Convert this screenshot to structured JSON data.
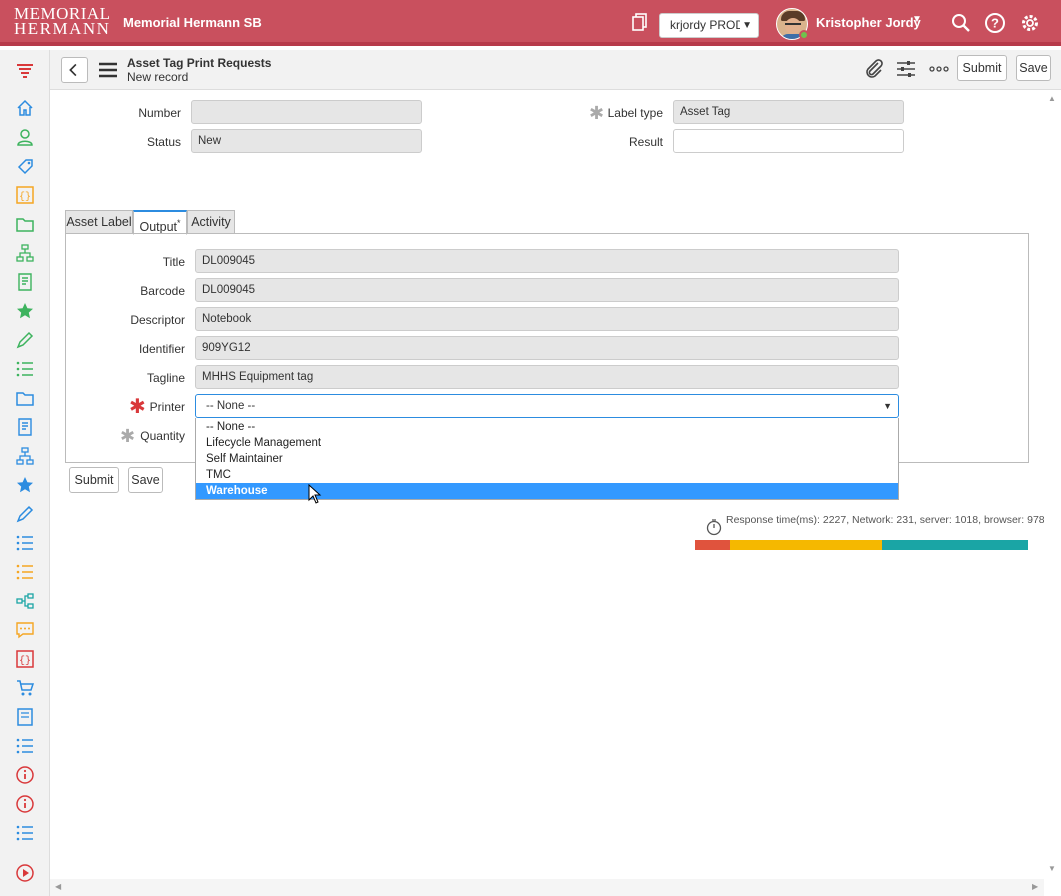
{
  "header": {
    "logo_line1": "MEMORIAL",
    "logo_line2": "HERMANN",
    "instance_name": "Memorial Hermann SB",
    "instance_select": "krjordy PROD",
    "user_name": "Kristopher Jordy"
  },
  "form_header": {
    "title": "Asset Tag Print Requests",
    "subtitle": "New record",
    "submit_label": "Submit",
    "save_label": "Save"
  },
  "form": {
    "number_label": "Number",
    "number_value": "",
    "status_label": "Status",
    "status_value": "New",
    "label_type_label": "Label type",
    "label_type_value": "Asset Tag",
    "result_label": "Result",
    "result_value": ""
  },
  "tabs": [
    {
      "label": "Asset Label"
    },
    {
      "label": "Output"
    },
    {
      "label": "Activity"
    }
  ],
  "output": {
    "title_label": "Title",
    "title_value": "DL009045",
    "barcode_label": "Barcode",
    "barcode_value": "DL009045",
    "descriptor_label": "Descriptor",
    "descriptor_value": "Notebook",
    "identifier_label": "Identifier",
    "identifier_value": "909YG12",
    "tagline_label": "Tagline",
    "tagline_value": "MHHS Equipment tag",
    "printer_label": "Printer",
    "printer_value": "-- None --",
    "quantity_label": "Quantity",
    "printer_options": [
      "-- None --",
      "Lifecycle Management",
      "Self Maintainer",
      "TMC",
      "Warehouse"
    ],
    "highlighted_option": "Warehouse"
  },
  "footer_buttons": {
    "submit_label": "Submit",
    "save_label": "Save"
  },
  "response": {
    "text": "Response time(ms): 2227, Network: 231, server: 1018, browser: 978",
    "total_ms": 2227,
    "network_ms": 231,
    "server_ms": 1018,
    "browser_ms": 978,
    "colors": {
      "network": "#e0533d",
      "server": "#f5b800",
      "browser": "#1aa5a5"
    }
  },
  "colors": {
    "header_bg": "#c9505e",
    "accent": "#2c8ce0",
    "selected_option": "#3399ff"
  }
}
